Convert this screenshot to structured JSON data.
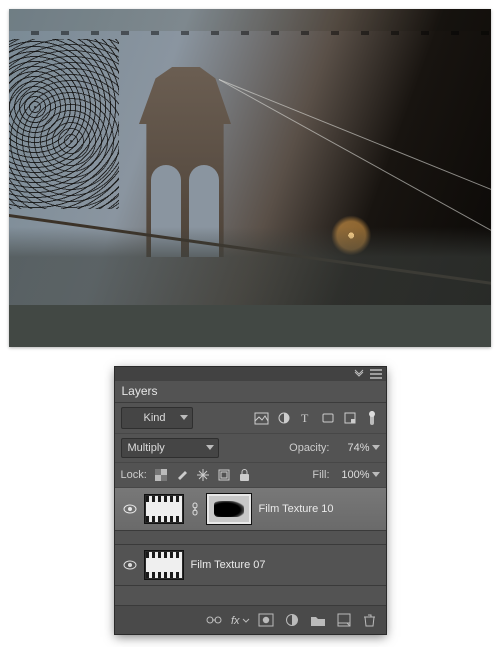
{
  "panel": {
    "title": "Layers",
    "kind_label": "Kind",
    "blend_mode": "Multiply",
    "opacity_label": "Opacity:",
    "opacity_value": "74%",
    "lock_label": "Lock:",
    "fill_label": "Fill:",
    "fill_value": "100%"
  },
  "layers": [
    {
      "name": "Film Texture 10",
      "selected": true,
      "visible": true,
      "has_mask": true
    },
    {
      "name": "Film Texture 07",
      "selected": false,
      "visible": true,
      "has_mask": false
    }
  ]
}
